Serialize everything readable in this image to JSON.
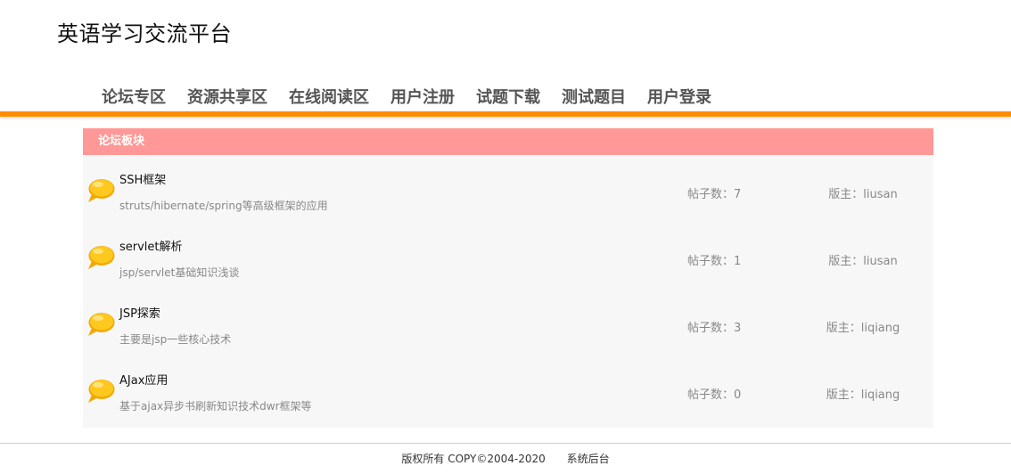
{
  "site": {
    "title": "英语学习交流平台"
  },
  "nav": {
    "items": [
      {
        "label": "论坛专区"
      },
      {
        "label": "资源共享区"
      },
      {
        "label": "在线阅读区"
      },
      {
        "label": "用户注册"
      },
      {
        "label": "试题下载"
      },
      {
        "label": "测试题目"
      },
      {
        "label": "用户登录"
      }
    ]
  },
  "board": {
    "header": "论坛板块",
    "forums": [
      {
        "name": "SSH框架",
        "desc": "struts/hibernate/spring等高级框架的应用",
        "posts": "帖子数：7",
        "moderator": "版主：liusan",
        "icon": "speech-bubble-icon"
      },
      {
        "name": "servlet解析",
        "desc": "jsp/servlet基础知识浅谈",
        "posts": "帖子数：1",
        "moderator": "版主：liusan",
        "icon": "speech-bubble-icon"
      },
      {
        "name": "JSP探索",
        "desc": "主要是jsp一些核心技术",
        "posts": "帖子数：3",
        "moderator": "版主：liqiang",
        "icon": "speech-bubble-icon"
      },
      {
        "name": "AJax应用",
        "desc": "基于ajax异步书刷新知识技术dwr框架等",
        "posts": "帖子数：0",
        "moderator": "版主：liqiang",
        "icon": "speech-bubble-icon"
      }
    ]
  },
  "footer": {
    "copyright": "版权所有 COPY©2004-2020",
    "admin": "系统后台"
  },
  "colors": {
    "accent": "#ff8c00",
    "board_header": "#ff9896",
    "board_bg": "#f7f7f7",
    "bubble": "#ffc20e"
  }
}
